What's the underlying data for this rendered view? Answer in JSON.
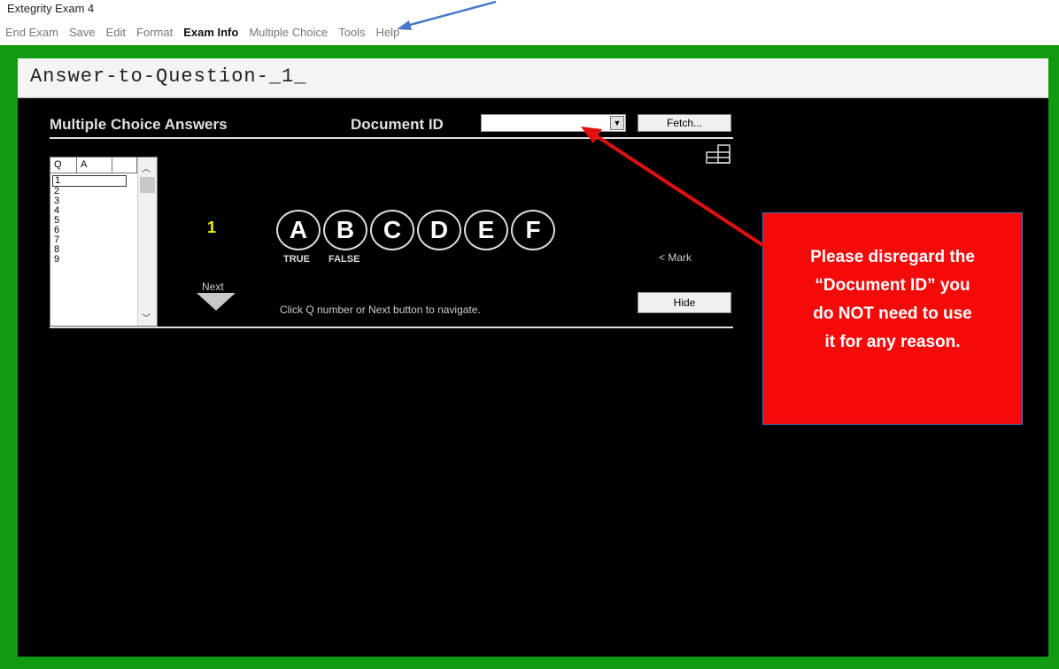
{
  "app": {
    "title": "Extegrity Exam 4"
  },
  "menu": [
    {
      "label": "End Exam",
      "active": false
    },
    {
      "label": "Save",
      "active": false
    },
    {
      "label": "Edit",
      "active": false
    },
    {
      "label": "Format",
      "active": false
    },
    {
      "label": "Exam Info",
      "active": true
    },
    {
      "label": "Multiple Choice",
      "active": false
    },
    {
      "label": "Tools",
      "active": false
    },
    {
      "label": "Help",
      "active": false
    }
  ],
  "document": {
    "title": "Answer-to-Question-_1_"
  },
  "mc_panel": {
    "title": "Multiple Choice Answers",
    "doc_id_label": "Document ID",
    "doc_id_value": "",
    "fetch_label": "Fetch...",
    "list_headers": [
      "Q",
      "A"
    ],
    "question_numbers": [
      "1",
      "2",
      "3",
      "4",
      "5",
      "6",
      "7",
      "8",
      "9"
    ],
    "current_question": "1",
    "choices": [
      "A",
      "B",
      "C",
      "D",
      "E",
      "F"
    ],
    "true_label": "TRUE",
    "false_label": "FALSE",
    "mark_label": "< Mark",
    "next_label": "Next",
    "hint": "Click Q number or Next button to navigate.",
    "hide_label": "Hide"
  },
  "notice": {
    "lines": [
      "Please disregard the",
      "“Document ID” you",
      "do NOT need to use",
      "it for any reason."
    ]
  },
  "colors": {
    "frame": "#109b10",
    "panel_bg": "#000000",
    "notice_bg": "#f50a0a",
    "question_number": "#f2f200",
    "arrow_red": "#e01010",
    "arrow_blue": "#4a78c8"
  }
}
